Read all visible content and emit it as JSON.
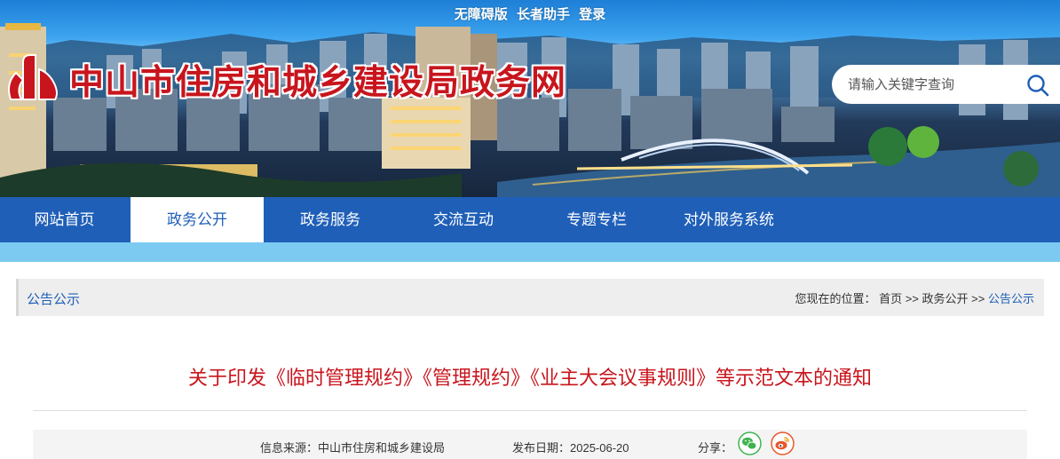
{
  "header": {
    "top_links": [
      "无障碍版",
      "长者助手",
      "登录"
    ],
    "site_title": "中山市住房和城乡建设局政务网",
    "search_placeholder": "请输入关键字查询",
    "colors": {
      "title_red": "#c8151d",
      "nav_blue": "#1f5fb8",
      "strip_blue": "#7ccaf2"
    }
  },
  "nav": {
    "items": [
      "网站首页",
      "政务公开",
      "政务服务",
      "交流互动",
      "专题专栏",
      "对外服务系统"
    ],
    "active": "政务公开"
  },
  "location": {
    "section": "公告公示",
    "prefix": "您现在的位置：",
    "crumbs": [
      "首页",
      "政务公开",
      "公告公示"
    ],
    "separator": ">>"
  },
  "article": {
    "title": "关于印发《临时管理规约》《管理规约》《业主大会议事规则》等示范文本的通知",
    "source_label": "信息来源：中山市住房和城乡建设局",
    "date_label": "发布日期：2025-06-20",
    "share_label": "分享：",
    "share_icons": [
      "wechat-icon",
      "weibo-icon"
    ]
  }
}
